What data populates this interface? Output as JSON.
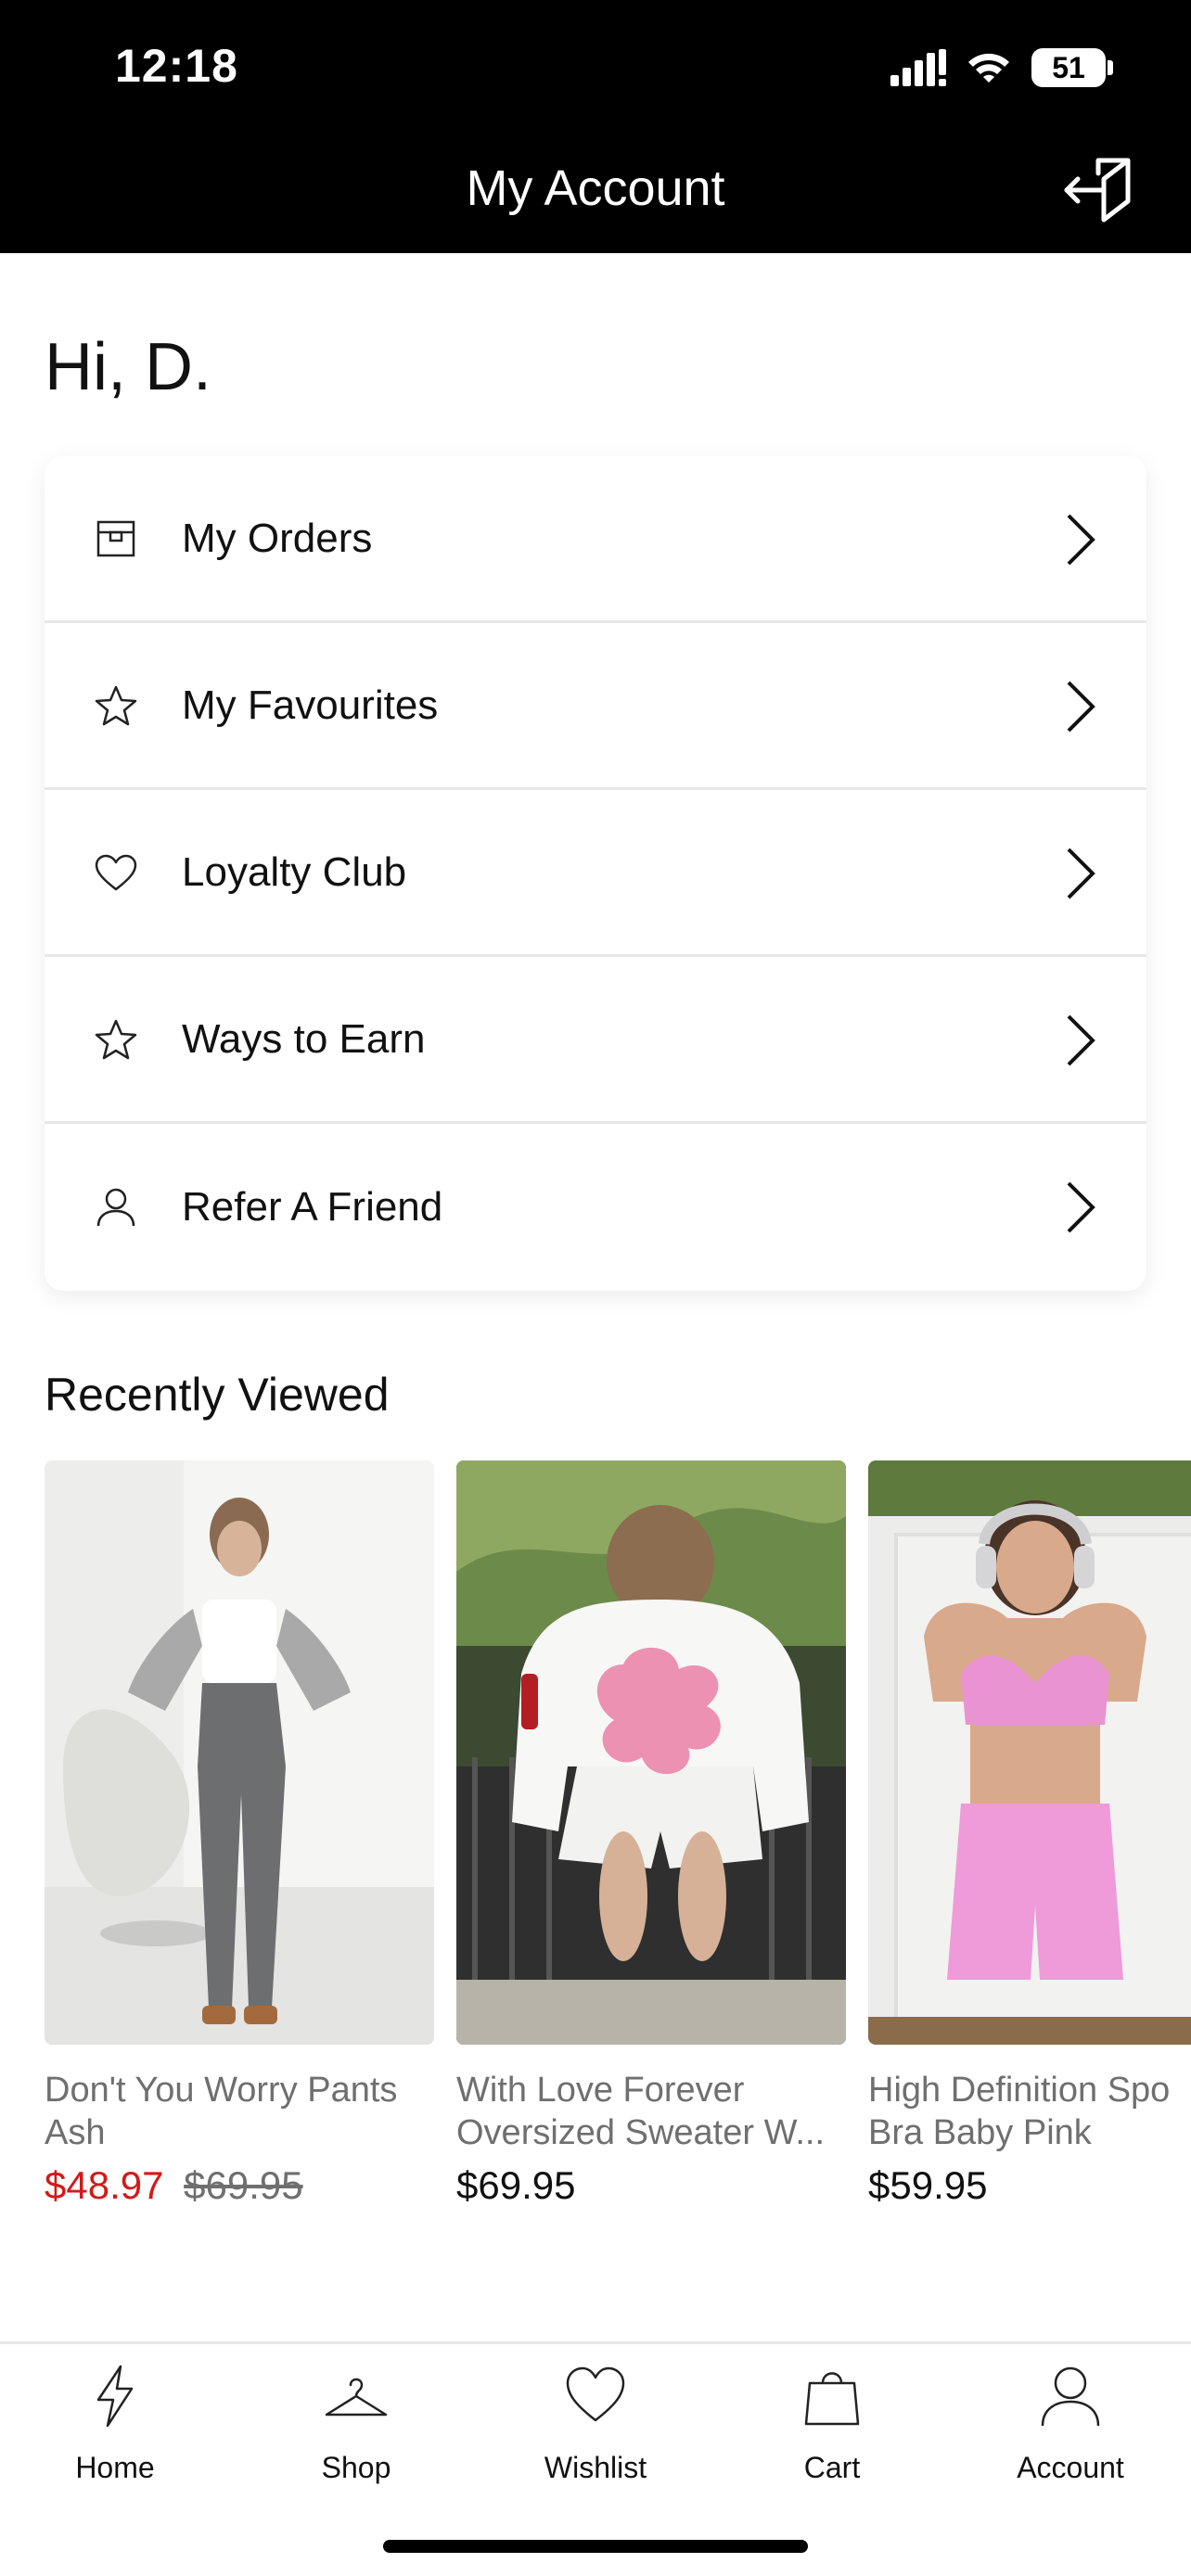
{
  "status_bar": {
    "time": "12:18",
    "battery": "51"
  },
  "header": {
    "title": "My Account"
  },
  "greeting": "Hi,  D.",
  "menu": [
    {
      "label": "My Orders",
      "icon": "package-icon"
    },
    {
      "label": "My Favourites",
      "icon": "star-icon"
    },
    {
      "label": "Loyalty Club",
      "icon": "heart-icon"
    },
    {
      "label": "Ways to Earn",
      "icon": "star-icon"
    },
    {
      "label": "Refer A Friend",
      "icon": "user-icon"
    }
  ],
  "recently_viewed": {
    "title": "Recently Viewed",
    "products": [
      {
        "name_line1": "Don't You Worry Pants",
        "name_line2": "Ash",
        "price": "$48.97",
        "old_price": "$69.95",
        "sale_color": "#d11a1a"
      },
      {
        "name_line1": "With Love Forever",
        "name_line2": "Oversized Sweater W...",
        "price": "$69.95"
      },
      {
        "name_line1": "High Definition Spo",
        "name_line2": "Bra Baby Pink",
        "price": "$59.95"
      }
    ]
  },
  "bottom_nav": [
    {
      "label": "Home",
      "icon": "lightning-icon"
    },
    {
      "label": "Shop",
      "icon": "hanger-icon"
    },
    {
      "label": "Wishlist",
      "icon": "heart-icon"
    },
    {
      "label": "Cart",
      "icon": "bag-icon"
    },
    {
      "label": "Account",
      "icon": "user-icon"
    }
  ]
}
